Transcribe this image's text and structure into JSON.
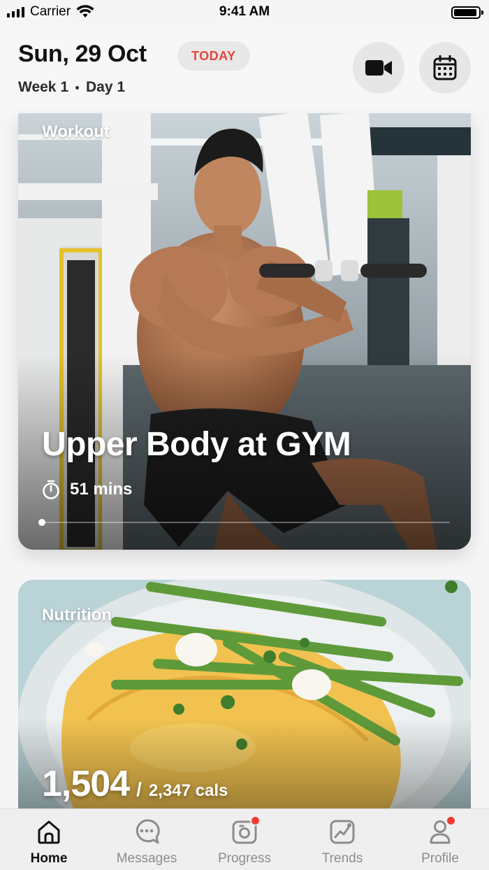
{
  "status_bar": {
    "carrier": "Carrier",
    "time": "9:41 AM"
  },
  "header": {
    "date": "Sun, 29 Oct",
    "today_badge": "TODAY",
    "week": "Week 1",
    "day": "Day 1",
    "video_icon": "video-camera-icon",
    "calendar_icon": "calendar-icon"
  },
  "workout": {
    "label": "Workout",
    "title": "Upper Body at GYM",
    "duration": "51 mins",
    "timer_icon": "stopwatch-icon",
    "progress": 0.0
  },
  "nutrition": {
    "label": "Nutrition",
    "consumed": "1,504",
    "separator": "/",
    "goal": "2,347 cals"
  },
  "tabs": [
    {
      "label": "Home",
      "icon": "home-icon",
      "active": true,
      "badge": false
    },
    {
      "label": "Messages",
      "icon": "chat-icon",
      "active": false,
      "badge": false
    },
    {
      "label": "Progress",
      "icon": "progress-camera-icon",
      "active": false,
      "badge": true
    },
    {
      "label": "Trends",
      "icon": "trends-icon",
      "active": false,
      "badge": false
    },
    {
      "label": "Profile",
      "icon": "profile-icon",
      "active": false,
      "badge": true
    }
  ],
  "colors": {
    "accent": "#e8443a",
    "badge": "#f03c35",
    "inactive_tab": "#8c8c8c"
  }
}
